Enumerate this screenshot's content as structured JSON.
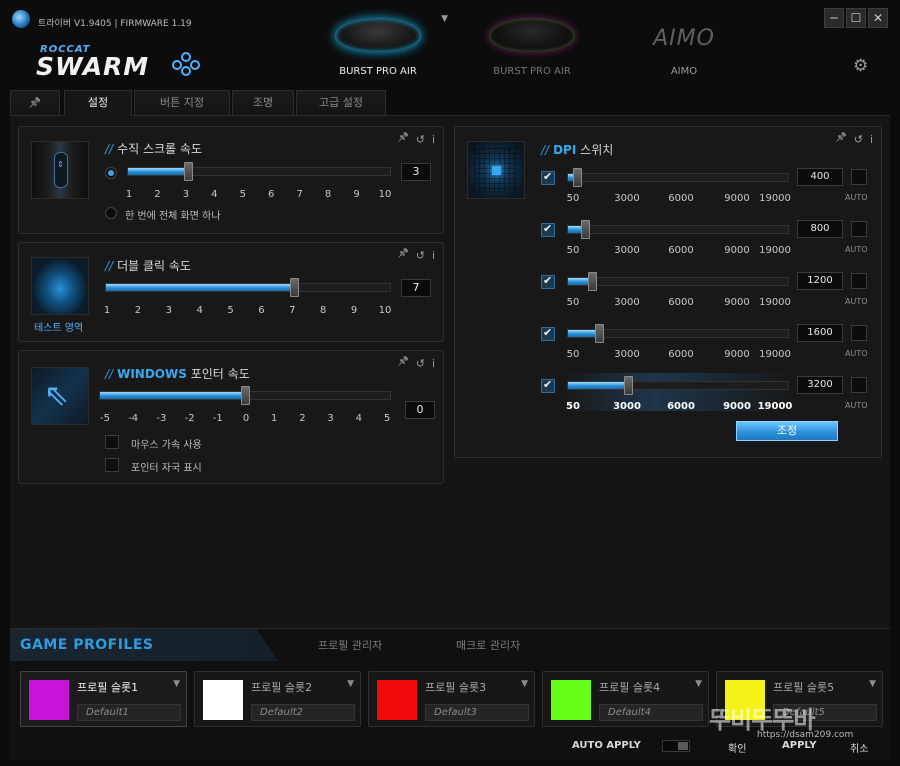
{
  "titlebar": {
    "version": "트라이버 V1.9405 | FIRMWARE 1.19",
    "min": "─",
    "max": "☐",
    "close": "✕"
  },
  "brand": {
    "small": "ROCCAT",
    "big": "SWARM"
  },
  "devices": [
    {
      "name": "BURST PRO AIR",
      "active": true
    },
    {
      "name": "BURST PRO AIR",
      "active": false
    },
    {
      "name": "AIMO",
      "logo": "AIMO",
      "active": false
    }
  ],
  "tabs": {
    "pin": "📌",
    "items": [
      "설정",
      "버튼 지정",
      "조명",
      "고급 설정"
    ],
    "active": 0
  },
  "panel_tools": {
    "pin": "📌",
    "reset": "↺",
    "info": "i"
  },
  "scroll": {
    "title": "수직 스크롤 속도",
    "slash": "//",
    "ticks": [
      "1",
      "2",
      "3",
      "4",
      "5",
      "6",
      "7",
      "8",
      "9",
      "10"
    ],
    "value": "3",
    "level": 3,
    "option_full": "한 번에 전체 화면 하나"
  },
  "dblclick": {
    "title": "더블 클릭 속도",
    "slash": "//",
    "ticks": [
      "1",
      "2",
      "3",
      "4",
      "5",
      "6",
      "7",
      "8",
      "9",
      "10"
    ],
    "value": "7",
    "level": 7,
    "test_area": "테스트 영역"
  },
  "pointer": {
    "title_bold": "WINDOWS",
    "title_rest": "포인터 속도",
    "slash": "//",
    "ticks": [
      "-5",
      "-4",
      "-3",
      "-2",
      "-1",
      "0",
      "1",
      "2",
      "3",
      "4",
      "5"
    ],
    "value": "0",
    "level": 0,
    "accel": "마우스 가속 사용",
    "trail": "포인터 자국 표시"
  },
  "dpi": {
    "title_bold": "DPI",
    "title_rest": "스위치",
    "slash": "//",
    "ticks": [
      "50",
      "3000",
      "6000",
      "9000",
      "19000"
    ],
    "auto": "AUTO",
    "rows": [
      {
        "value": "400",
        "enabled": true
      },
      {
        "value": "800",
        "enabled": true
      },
      {
        "value": "1200",
        "enabled": true
      },
      {
        "value": "1600",
        "enabled": true
      },
      {
        "value": "3200",
        "enabled": true,
        "active": true
      }
    ],
    "adjust": "조정"
  },
  "profiles": {
    "title": "GAME PROFILES",
    "sub_tabs": [
      "프로필 관리자",
      "매크로 관리자"
    ],
    "slots": [
      {
        "name": "프로필 슬롯1",
        "profile": "Default1",
        "color": "#c814d8",
        "active": true
      },
      {
        "name": "프로필 슬롯2",
        "profile": "Default2",
        "color": "#ffffff",
        "active": false
      },
      {
        "name": "프로필 슬롯3",
        "profile": "Default3",
        "color": "#f00a0a",
        "active": false
      },
      {
        "name": "프로필 슬롯4",
        "profile": "Default4",
        "color": "#66ff1a",
        "active": false
      },
      {
        "name": "프로필 슬롯5",
        "profile": "Default5",
        "color": "#f3f318",
        "active": false
      }
    ]
  },
  "footer": {
    "auto_apply": "AUTO APPLY",
    "ok": "확인",
    "apply": "APPLY",
    "cancel": "취소"
  },
  "watermark": {
    "text": "뚜비뚜뚜바",
    "url": "https://dsam209.com"
  },
  "colors": {
    "accent": "#2f9be0",
    "bg": "#151515"
  }
}
